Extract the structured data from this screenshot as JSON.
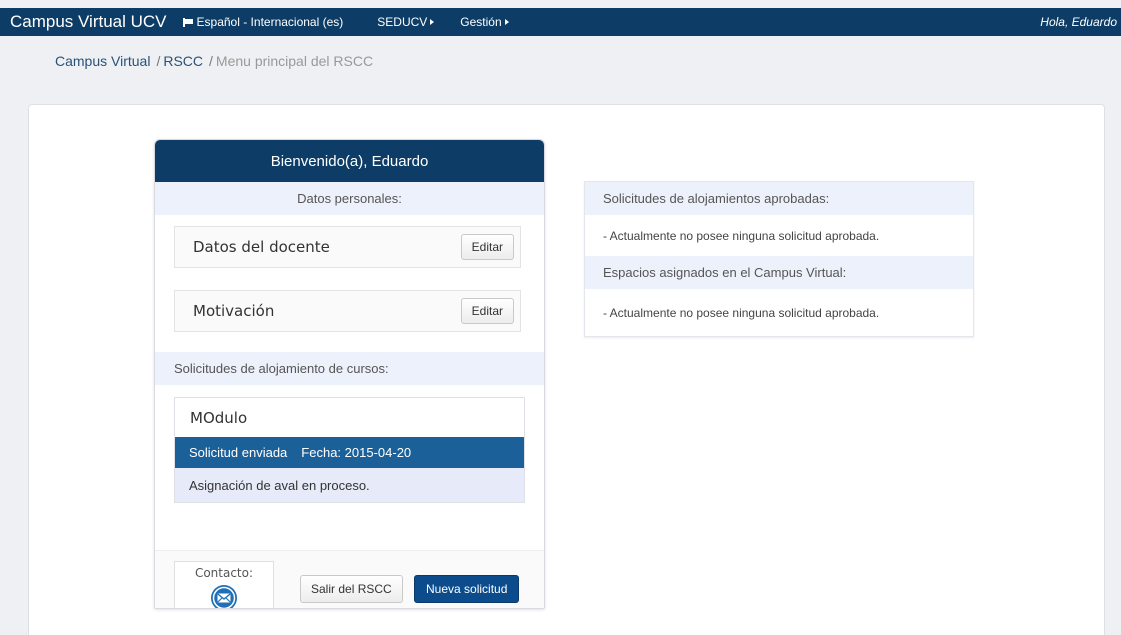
{
  "navbar": {
    "brand": "Campus Virtual UCV",
    "language": "Español - Internacional (es)",
    "menu_seducv": "SEDUCV",
    "menu_gestion": "Gestión",
    "user_greeting": "Hola, Eduardo",
    "background_color": "#0d3d66"
  },
  "breadcrumb": {
    "items": [
      "Campus Virtual",
      "RSCC",
      "Menu principal del RSCC"
    ],
    "separator": "/"
  },
  "left_card": {
    "header": "Bienvenido(a), Eduardo",
    "personal_section_title": "Datos personales:",
    "teacher_data_label": "Datos del docente",
    "teacher_edit_label": "Editar",
    "motivation_label": "Motivación",
    "motivation_edit_label": "Editar",
    "requests_section_title": "Solicitudes de alojamiento de cursos:",
    "module": {
      "title": "MOdulo",
      "status": "Solicitud enviada",
      "date": "Fecha: 2015-04-20",
      "note": "Asignación de aval en proceso."
    },
    "contact_label": "Contacto:",
    "exit_button": "Salir del RSCC",
    "new_request_button": "Nueva solicitud"
  },
  "right_panel": {
    "approved_title": "Solicitudes de alojamientos aprobadas:",
    "approved_text": "- Actualmente no posee ninguna solicitud aprobada.",
    "spaces_title": "Espacios asignados en el Campus Virtual:",
    "spaces_text": "- Actualmente no posee ninguna solicitud aprobada."
  },
  "icons": {
    "language": "flag-icon",
    "menu_caret": "caret-right-icon",
    "contact": "envelope-icon"
  }
}
